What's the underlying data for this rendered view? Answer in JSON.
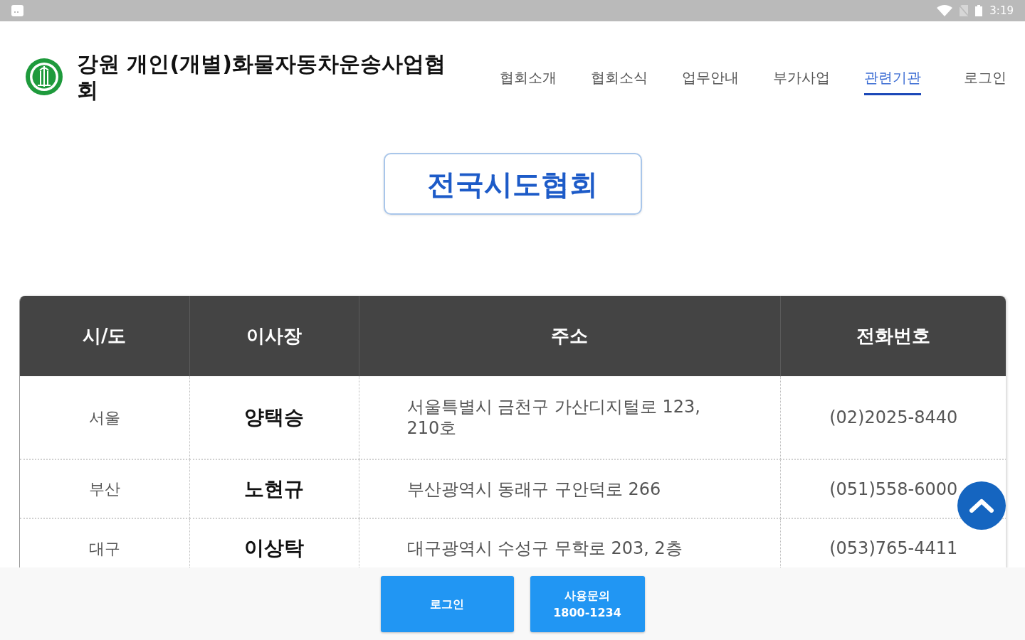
{
  "status_bar": {
    "time": "3:19"
  },
  "header": {
    "title": "강원 개인(개별)화물자동차운송사업협회",
    "nav": [
      {
        "label": "협회소개",
        "selected": false
      },
      {
        "label": "협회소식",
        "selected": false
      },
      {
        "label": "업무안내",
        "selected": false
      },
      {
        "label": "부가사업",
        "selected": false
      },
      {
        "label": "관련기관",
        "selected": true
      },
      {
        "label": "로그인",
        "selected": false
      }
    ]
  },
  "page_title": "전국시도협회",
  "table": {
    "columns": [
      "시/도",
      "이사장",
      "주소",
      "전화번호"
    ],
    "rows": [
      {
        "region": "서울",
        "chairman": "양택승",
        "address": "서울특별시 금천구 가산디지털로 123, 210호",
        "phone": "(02)2025-8440"
      },
      {
        "region": "부산",
        "chairman": "노현규",
        "address": "부산광역시 동래구 구안덕로 266",
        "phone": "(051)558-6000"
      },
      {
        "region": "대구",
        "chairman": "이상탁",
        "address": "대구광역시 수성구 무학로 203, 2층",
        "phone": "(053)765-4411"
      }
    ]
  },
  "bottom_bar": {
    "buttons": [
      {
        "kind": "single",
        "label": "로그인"
      },
      {
        "kind": "double",
        "label": "사용문의",
        "number": "1800-1234"
      }
    ]
  }
}
